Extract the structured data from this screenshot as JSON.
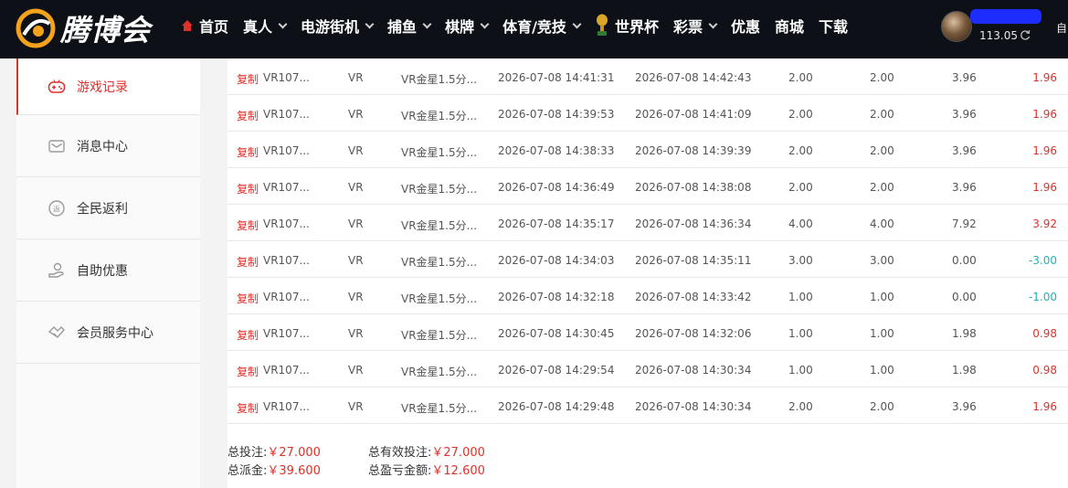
{
  "header": {
    "logo_text": "腾博会",
    "nav": [
      {
        "label": "首页",
        "icon": "home-icon",
        "has_dropdown": false
      },
      {
        "label": "真人",
        "has_dropdown": true
      },
      {
        "label": "电游街机",
        "has_dropdown": true
      },
      {
        "label": "捕鱼",
        "has_dropdown": true
      },
      {
        "label": "棋牌",
        "has_dropdown": true
      },
      {
        "label": "体育/竞技",
        "has_dropdown": true
      },
      {
        "label": "世界杯",
        "icon": "trophy-icon",
        "has_dropdown": false
      },
      {
        "label": "彩票",
        "has_dropdown": true
      },
      {
        "label": "优惠",
        "has_dropdown": false
      },
      {
        "label": "商城",
        "has_dropdown": false
      },
      {
        "label": "下载",
        "has_dropdown": false
      }
    ],
    "user": {
      "balance": "113.05",
      "clipped_text": "自"
    },
    "colors": {
      "bar_bg": "#0d1016",
      "home_icon": "#e0302a",
      "username_mask": "#1d2cff"
    }
  },
  "sidebar": {
    "items": [
      {
        "label": "游戏记录",
        "icon": "gamepad-icon",
        "active": true
      },
      {
        "label": "消息中心",
        "icon": "mail-icon",
        "active": false
      },
      {
        "label": "全民返利",
        "icon": "rebate-icon",
        "active": false
      },
      {
        "label": "自助优惠",
        "icon": "hand-coin-icon",
        "active": false
      },
      {
        "label": "会员服务中心",
        "icon": "handshake-icon",
        "active": false
      }
    ],
    "active_color": "#e0302a"
  },
  "records": {
    "copy_label": "复制",
    "rows": [
      {
        "id": "VR107...",
        "platform": "VR",
        "game": "VR金星1.5分...",
        "bet_time": "2026-07-08 14:41:31",
        "settle_time": "2026-07-08 14:42:43",
        "bet": "2.00",
        "valid_bet": "2.00",
        "payout": "3.96",
        "win_loss": "1.96",
        "sign": "pos"
      },
      {
        "id": "VR107...",
        "platform": "VR",
        "game": "VR金星1.5分...",
        "bet_time": "2026-07-08 14:39:53",
        "settle_time": "2026-07-08 14:41:09",
        "bet": "2.00",
        "valid_bet": "2.00",
        "payout": "3.96",
        "win_loss": "1.96",
        "sign": "pos"
      },
      {
        "id": "VR107...",
        "platform": "VR",
        "game": "VR金星1.5分...",
        "bet_time": "2026-07-08 14:38:33",
        "settle_time": "2026-07-08 14:39:39",
        "bet": "2.00",
        "valid_bet": "2.00",
        "payout": "3.96",
        "win_loss": "1.96",
        "sign": "pos"
      },
      {
        "id": "VR107...",
        "platform": "VR",
        "game": "VR金星1.5分...",
        "bet_time": "2026-07-08 14:36:49",
        "settle_time": "2026-07-08 14:38:08",
        "bet": "2.00",
        "valid_bet": "2.00",
        "payout": "3.96",
        "win_loss": "1.96",
        "sign": "pos"
      },
      {
        "id": "VR107...",
        "platform": "VR",
        "game": "VR金星1.5分...",
        "bet_time": "2026-07-08 14:35:17",
        "settle_time": "2026-07-08 14:36:34",
        "bet": "4.00",
        "valid_bet": "4.00",
        "payout": "7.92",
        "win_loss": "3.92",
        "sign": "pos"
      },
      {
        "id": "VR107...",
        "platform": "VR",
        "game": "VR金星1.5分...",
        "bet_time": "2026-07-08 14:34:03",
        "settle_time": "2026-07-08 14:35:11",
        "bet": "3.00",
        "valid_bet": "3.00",
        "payout": "0.00",
        "win_loss": "-3.00",
        "sign": "neg"
      },
      {
        "id": "VR107...",
        "platform": "VR",
        "game": "VR金星1.5分...",
        "bet_time": "2026-07-08 14:32:18",
        "settle_time": "2026-07-08 14:33:42",
        "bet": "1.00",
        "valid_bet": "1.00",
        "payout": "0.00",
        "win_loss": "-1.00",
        "sign": "neg"
      },
      {
        "id": "VR107...",
        "platform": "VR",
        "game": "VR金星1.5分...",
        "bet_time": "2026-07-08 14:30:45",
        "settle_time": "2026-07-08 14:32:06",
        "bet": "1.00",
        "valid_bet": "1.00",
        "payout": "1.98",
        "win_loss": "0.98",
        "sign": "pos"
      },
      {
        "id": "VR107...",
        "platform": "VR",
        "game": "VR金星1.5分...",
        "bet_time": "2026-07-08 14:29:54",
        "settle_time": "2026-07-08 14:30:34",
        "bet": "1.00",
        "valid_bet": "1.00",
        "payout": "1.98",
        "win_loss": "0.98",
        "sign": "pos"
      },
      {
        "id": "VR107...",
        "platform": "VR",
        "game": "VR金星1.5分...",
        "bet_time": "2026-07-08 14:29:48",
        "settle_time": "2026-07-08 14:30:34",
        "bet": "2.00",
        "valid_bet": "2.00",
        "payout": "3.96",
        "win_loss": "1.96",
        "sign": "pos"
      }
    ],
    "colors": {
      "positive": "#e0302a",
      "negative": "#1fb3b1"
    }
  },
  "summary": {
    "total_bet_label": "总投注:",
    "total_bet_value": "￥27.000",
    "total_payout_label": "总派金:",
    "total_payout_value": "￥39.600",
    "total_valid_bet_label": "总有效投注:",
    "total_valid_bet_value": "￥27.000",
    "total_profit_label": "总盈亏金额:",
    "total_profit_value": "￥12.600"
  }
}
